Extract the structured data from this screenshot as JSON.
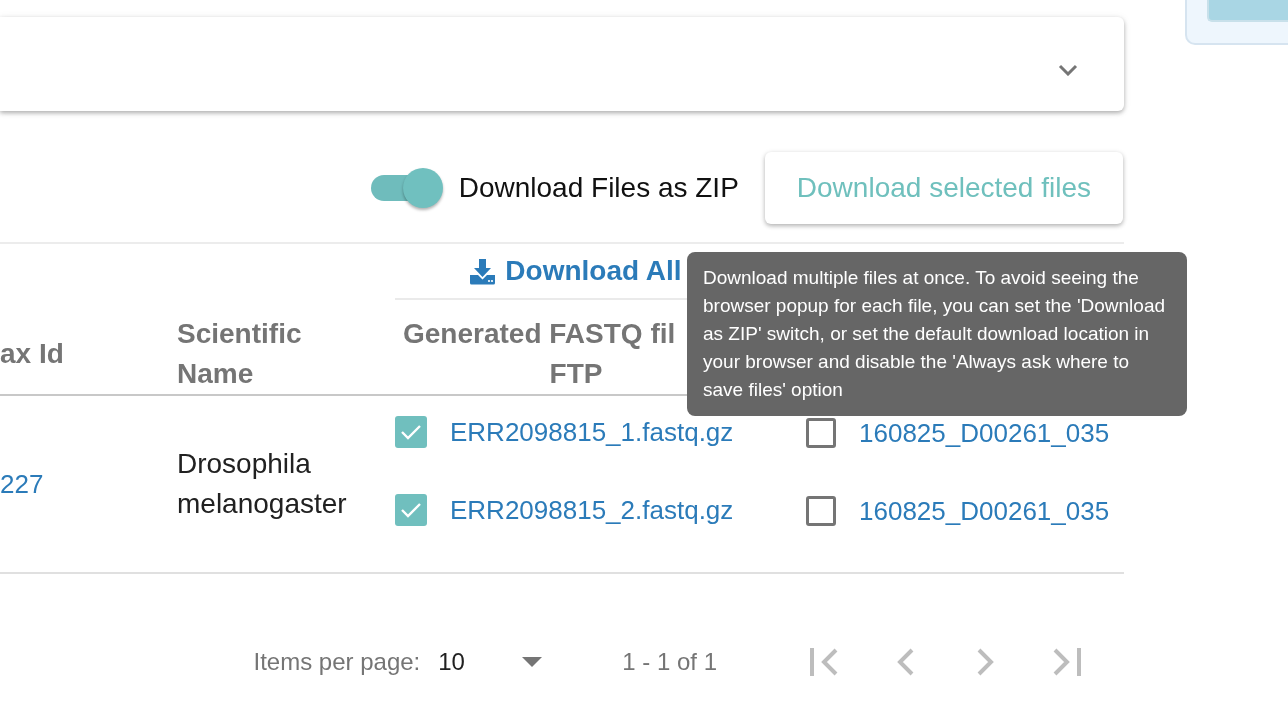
{
  "expansion_panel": {
    "expanded": false
  },
  "zip_switch": {
    "label": "Download Files as ZIP",
    "on": true
  },
  "download_selected_button": {
    "label": "Download selected files"
  },
  "table": {
    "group_headers": [
      {
        "label": "Download All"
      }
    ],
    "columns": [
      {
        "label": "ax Id"
      },
      {
        "label": "Scientific Name"
      },
      {
        "label": "Generated FASTQ fil",
        "label_2": "FTP"
      }
    ],
    "rows": [
      {
        "tax_id": "227",
        "scientific_name": "Drosophila melanogaster",
        "generated_files": [
          {
            "name": "ERR2098815_1.fastq.gz",
            "checked": true
          },
          {
            "name": "ERR2098815_2.fastq.gz",
            "checked": true
          }
        ],
        "submitted_files": [
          {
            "name": "160825_D00261_035",
            "checked": false
          },
          {
            "name": "160825_D00261_035",
            "checked": false
          }
        ]
      }
    ]
  },
  "tooltip": {
    "text": "Download multiple files at once. To avoid seeing the browser popup for each file, you can set the 'Download as ZIP' switch, or set the default download location in your browser and disable the 'Always ask where to save files' option"
  },
  "paginator": {
    "items_per_page_label": "Items per page:",
    "page_size": "10",
    "range": "1 - 1 of 1",
    "nav_buttons": [
      {
        "kind": "first",
        "disabled": true
      },
      {
        "kind": "previous",
        "disabled": true
      },
      {
        "kind": "next",
        "disabled": true
      },
      {
        "kind": "last",
        "disabled": true
      }
    ]
  }
}
